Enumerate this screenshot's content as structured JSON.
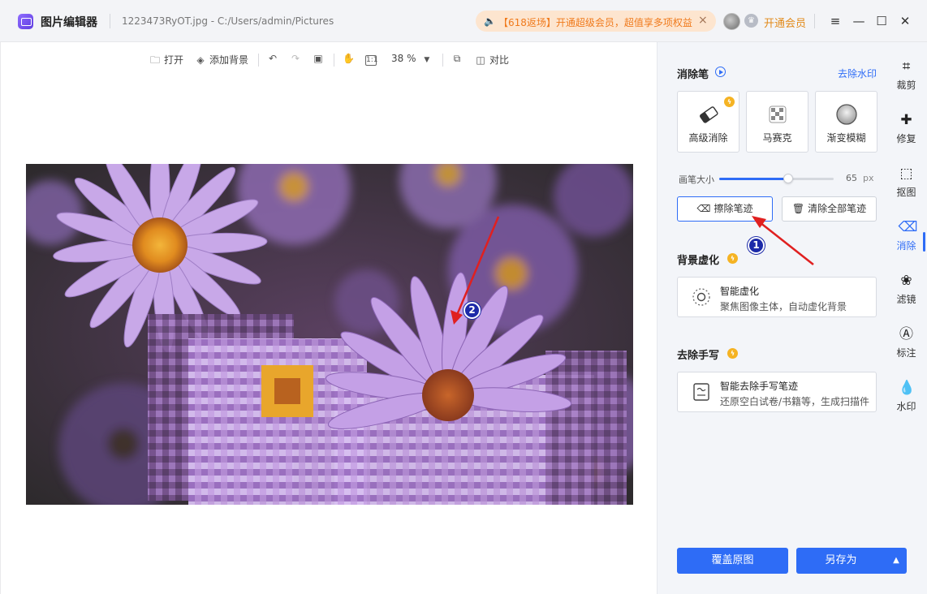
{
  "titlebar": {
    "app_name": "图片编辑器",
    "file_path": "1223473RyOT.jpg - C:/Users/admin/Pictures",
    "promo_text": "【618返场】开通超级会员，超值享多项权益",
    "promo_close": "×",
    "vip_link": "开通会员",
    "menu_icon": "≡",
    "minimize_icon": "—",
    "maximize_icon": "☐",
    "close_icon": "✕"
  },
  "toolbar": {
    "open": "打开",
    "add_background": "添加背景",
    "zoom": "38 %",
    "compare": "对比"
  },
  "panel": {
    "eraser": {
      "title": "消除笔",
      "remove_watermark": "去除水印",
      "tools": [
        "高级消除",
        "马赛克",
        "渐变模糊"
      ],
      "brush_size_label": "画笔大小",
      "brush_size_value": "65",
      "brush_size_unit": "px",
      "brush_size_fraction": 0.6,
      "erase_strokes": "擦除笔迹",
      "clear_all_strokes": "清除全部笔迹"
    },
    "blur": {
      "title": "背景虚化",
      "feature_title": "智能虚化",
      "feature_sub": "聚焦图像主体，自动虚化背景"
    },
    "handwriting": {
      "title": "去除手写",
      "feature_title": "智能去除手写笔迹",
      "feature_sub": "还原空白试卷/书籍等，生成扫描件"
    },
    "overwrite_button": "覆盖原图",
    "save_as_button": "另存为",
    "save_as_caret": "▲"
  },
  "rail": {
    "items": [
      "裁剪",
      "修复",
      "抠图",
      "消除",
      "滤镜",
      "标注",
      "水印"
    ]
  },
  "markers": [
    "1",
    "2"
  ],
  "colors": {
    "accent": "#2e6cf6",
    "promo_text": "#f07a1c",
    "vip": "#e28a1a",
    "annotation_arrow": "#e02020",
    "marker": "#1c2aa8"
  }
}
